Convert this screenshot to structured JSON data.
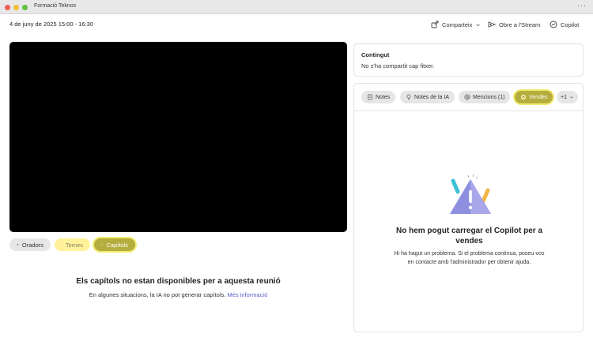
{
  "window": {
    "title": "Formació Teknos",
    "more": "···"
  },
  "toolbar": {
    "date": "4 de juny de 2025 15:00 - 16:30",
    "share_label": "Comparteix",
    "stream_label": "Obre a l'Stream",
    "copilot_label": "Copilot"
  },
  "video_panel": {
    "pills": {
      "orators": "Oradors",
      "temes": "Temes",
      "capitols": "Capítols"
    },
    "chapters_title": "Els capítols no estan disponibles per a aquesta reunió",
    "chapters_text": "En algunes situacions, la IA no pot generar capítols.",
    "chapters_link": "Més informació"
  },
  "content_card": {
    "title": "Contingut",
    "text": "No s'ha compartit cap fitxer."
  },
  "notes_card": {
    "tabs": {
      "notes": "Notes",
      "ia_notes": "Notes de la IA",
      "mentions": "Mencions (1)",
      "vendes": "Vendes",
      "more": "+1"
    },
    "error_title": "No hem pogut carregar el Copilot per a vendes",
    "error_text": "Hi ha hagut un problema. Si el problema continua, poseu-vos en contacte amb l'administrador per obtenir ajuda."
  },
  "colors": {
    "highlight": "#fff29a",
    "active_pill": "#b5ad3e",
    "link": "#5b5fc7"
  }
}
